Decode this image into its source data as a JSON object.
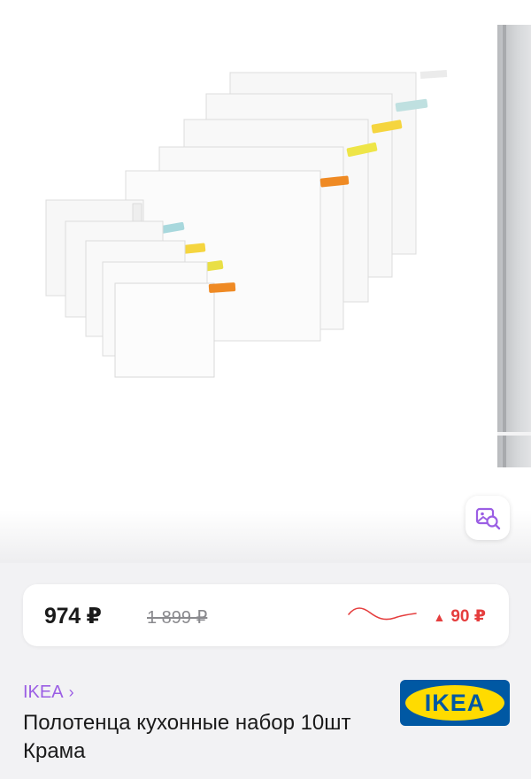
{
  "gallery": {
    "image_alt": "Полотенца кухонные набор 10шт Крама",
    "image_search_icon": "image-search-icon"
  },
  "price": {
    "current": "974 ₽",
    "old": "1 899 ₽",
    "change": "90 ₽",
    "change_icon": "triangle-up-icon",
    "colors": {
      "trend": "#e53e3e",
      "accent": "#9b5ee4"
    }
  },
  "product": {
    "brand": "IKEA",
    "brand_chevron": "›",
    "title": "Полотенца кухонные набор 10шт Крама",
    "logo_text": "IKEA",
    "logo_colors": {
      "background": "#0058a3",
      "oval": "#ffdb00",
      "text": "#0058a3"
    }
  }
}
